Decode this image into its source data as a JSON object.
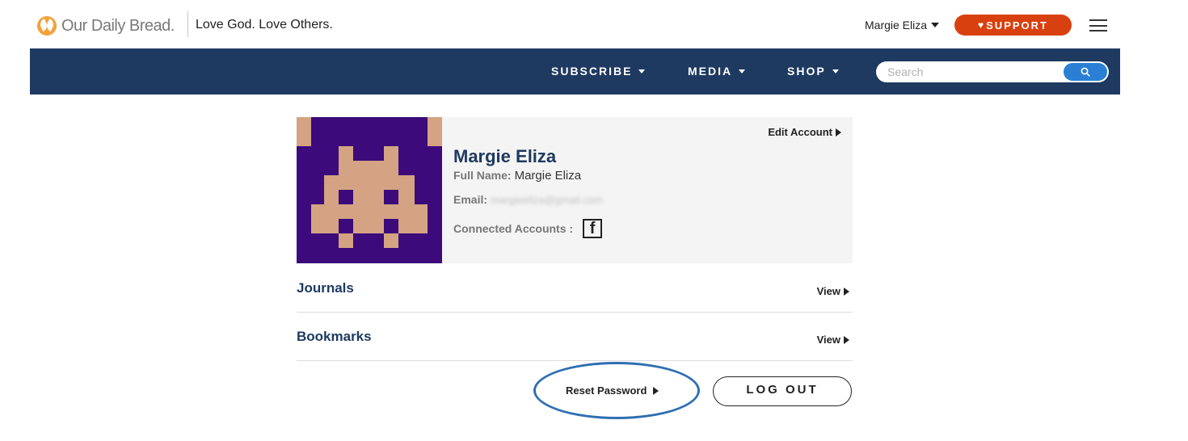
{
  "header": {
    "logo_text": "Our Daily Bread.",
    "tagline": "Love God. Love Others.",
    "user_menu_label": "Margie Eliza",
    "support_label": "SUPPORT",
    "icons": [
      "logo-icon",
      "heart-icon",
      "hamburger-icon",
      "chevron-down-icon"
    ]
  },
  "nav": {
    "items": [
      {
        "label": "SUBSCRIBE"
      },
      {
        "label": "MEDIA"
      },
      {
        "label": "SHOP"
      }
    ],
    "search_placeholder": "Search",
    "search_icon": "search-icon"
  },
  "profile": {
    "name": "Margie Eliza",
    "edit_label": "Edit Account",
    "full_name_label": "Full Name:",
    "full_name_value": "Margie Eliza",
    "email_label": "Email:",
    "email_value": "margieeliza@gmail.com",
    "connected_label": "Connected Accounts :",
    "connected_icon": "facebook-icon",
    "avatar_colors": {
      "background": "#3c0a7a",
      "figure": "#d4a383",
      "side": "#f4f4f4"
    }
  },
  "sections": [
    {
      "title": "Journals",
      "action": "View"
    },
    {
      "title": "Bookmarks",
      "action": "View"
    }
  ],
  "actions": {
    "reset_password_label": "Reset Password",
    "logout_label": "LOG OUT"
  },
  "colors": {
    "navy": "#1e3a61",
    "support_orange": "#d9400f",
    "search_blue": "#2a7fd4",
    "highlight_ring": "#2f6fb2"
  }
}
